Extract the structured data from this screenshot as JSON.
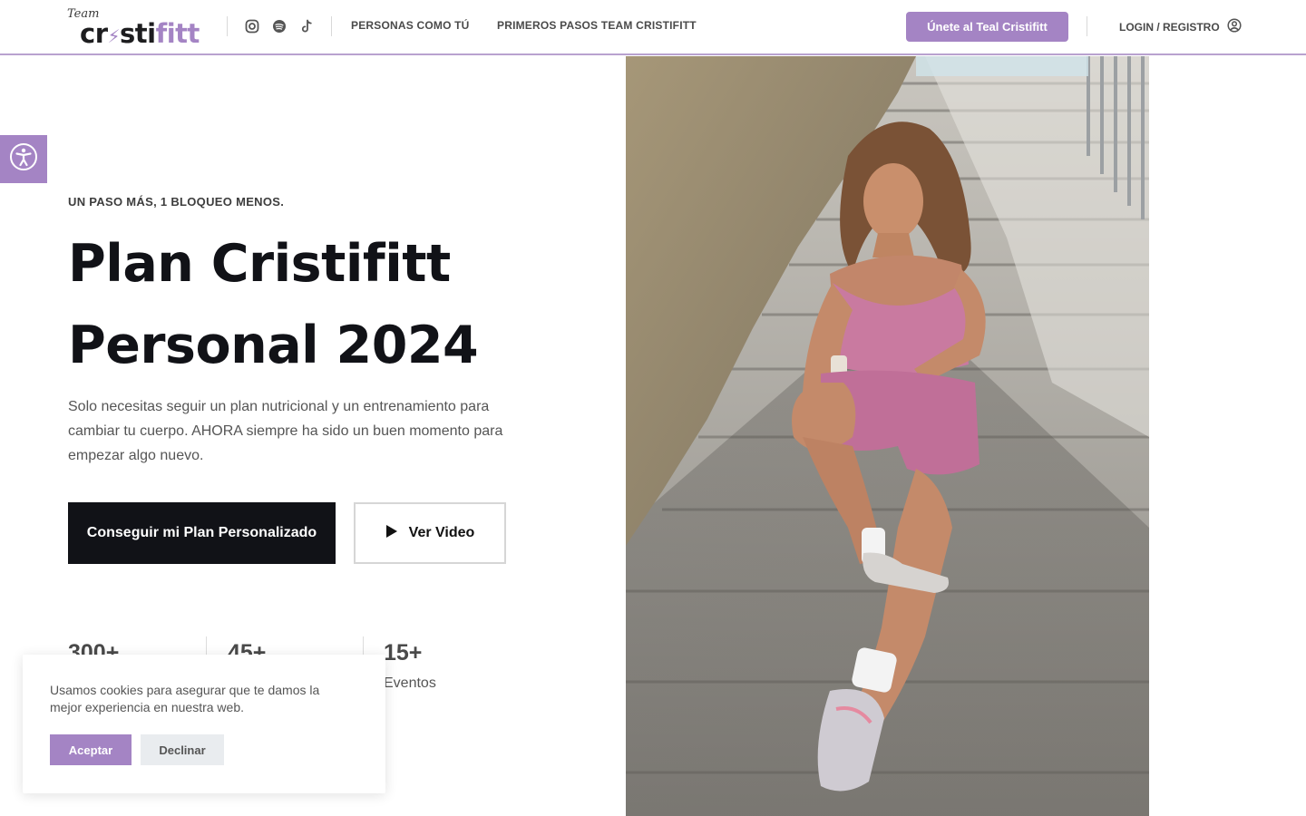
{
  "header": {
    "logo_small": "Team",
    "logo_main": "cr",
    "logo_bolt": "⚡",
    "logo_dark": "sti",
    "logo_accent": "fitt",
    "social_icons": [
      "instagram-icon",
      "spotify-icon",
      "tiktok-icon"
    ],
    "nav": [
      "PERSONAS COMO TÚ",
      "PRIMEROS PASOS TEAM CRISTIFITT"
    ],
    "join_label": "Únete al Teal Cristifitt",
    "login_label": "LOGIN / REGISTRO"
  },
  "hero": {
    "eyebrow": "UN PASO MÁS, 1 BLOQUEO MENOS.",
    "title_line1": "Plan Cristifitt",
    "title_line2": "Personal 2024",
    "description": "Solo necesitas seguir un plan nutricional y un entrenamiento para cambiar tu cuerpo. AHORA siempre ha sido un buen momento para empezar algo nuevo.",
    "primary_cta": "Conseguir mi Plan Personalizado",
    "video_cta": "Ver Video"
  },
  "stats": [
    {
      "num": "300+",
      "label": ""
    },
    {
      "num": "45+",
      "label": ""
    },
    {
      "num": "15+",
      "label": "Eventos"
    }
  ],
  "cookie": {
    "text": "Usamos cookies para asegurar que te damos la mejor experiencia en nuestra web.",
    "accept": "Aceptar",
    "decline": "Declinar"
  },
  "colors": {
    "accent": "#a484c4",
    "dark": "#111217",
    "pink_outfit": "#c97aa0"
  }
}
